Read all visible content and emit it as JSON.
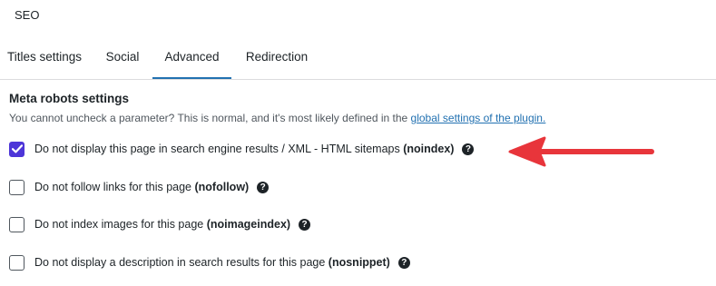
{
  "panel": {
    "title": "SEO"
  },
  "tabs": [
    {
      "label": "Titles settings",
      "active": false
    },
    {
      "label": "Social",
      "active": false
    },
    {
      "label": "Advanced",
      "active": true
    },
    {
      "label": "Redirection",
      "active": false
    }
  ],
  "section": {
    "heading": "Meta robots settings",
    "description": "You cannot uncheck a parameter? This is normal, and it's most likely defined in the",
    "link_text": "global settings of the plugin."
  },
  "options": [
    {
      "label": "Do not display this page in search engine results / XML - HTML sitemaps",
      "key": "(noindex)",
      "checked": true,
      "help_glyph": "?"
    },
    {
      "label": "Do not follow links for this page",
      "key": "(nofollow)",
      "checked": false,
      "help_glyph": "?"
    },
    {
      "label": "Do not index images for this page",
      "key": "(noimageindex)",
      "checked": false,
      "help_glyph": "?"
    },
    {
      "label": "Do not display a description in search results for this page",
      "key": "(nosnippet)",
      "checked": false,
      "help_glyph": "?"
    }
  ],
  "colors": {
    "accent_tab": "#2271b1",
    "checkbox_checked": "#4d35d8",
    "link": "#2271b1",
    "annotation_arrow": "#e8353b"
  },
  "icons": {
    "checkmark": "checkmark-icon",
    "help": "question-circle-icon",
    "annotation": "red-arrow-icon"
  }
}
